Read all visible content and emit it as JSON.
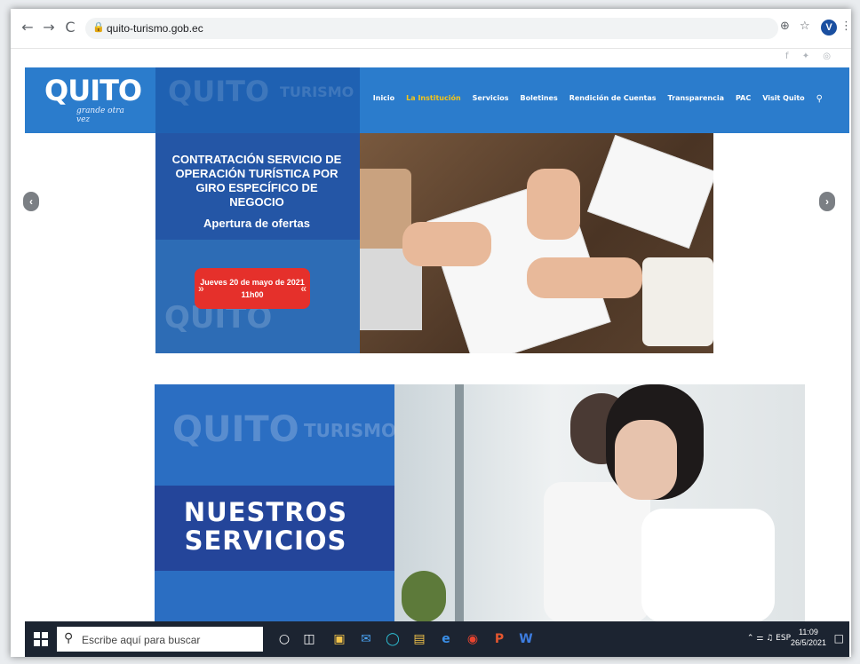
{
  "browser": {
    "url": "quito-turismo.gob.ec",
    "back_icon": "←",
    "forward_icon": "→",
    "reload_icon": "C",
    "zoom_icon": "⊕",
    "star_icon": "☆",
    "profile_letter": "V",
    "menu_icon": "⋮"
  },
  "social_icons": "f  ✦  ◎",
  "site": {
    "logo": "QUITO",
    "logo_tagline": "grande otra vez",
    "ghost_logo": "QUITO",
    "ghost_turismo": "TURISMO",
    "menu": [
      "Inicio",
      "La Institución",
      "Servicios",
      "Boletines",
      "Rendición de Cuentas",
      "Transparencia",
      "PAC",
      "Visit Quito"
    ],
    "active_menu_index": 1,
    "colors": {
      "header": "#2b7ccc",
      "active": "#f5c518",
      "banner_dark": "#24459a",
      "pill": "#e5302b"
    }
  },
  "slide1": {
    "title": "CONTRATACIÓN SERVICIO DE OPERACIÓN TURÍSTICA POR GIRO ESPECÍFICO DE NEGOCIO",
    "subtitle": "Apertura de ofertas",
    "pill_line1": "Jueves 20 de mayo de 2021",
    "pill_line2": "11h00",
    "ghost": "QUITO"
  },
  "slide2": {
    "title_line1": "NUESTROS",
    "title_line2": "SERVICIOS",
    "ghost1": "QUITO",
    "ghost2": "TURISMO"
  },
  "taskbar": {
    "search_placeholder": "Escribe aquí para buscar",
    "lang": "ESP",
    "time": "11:09",
    "date": "26/5/2021"
  }
}
